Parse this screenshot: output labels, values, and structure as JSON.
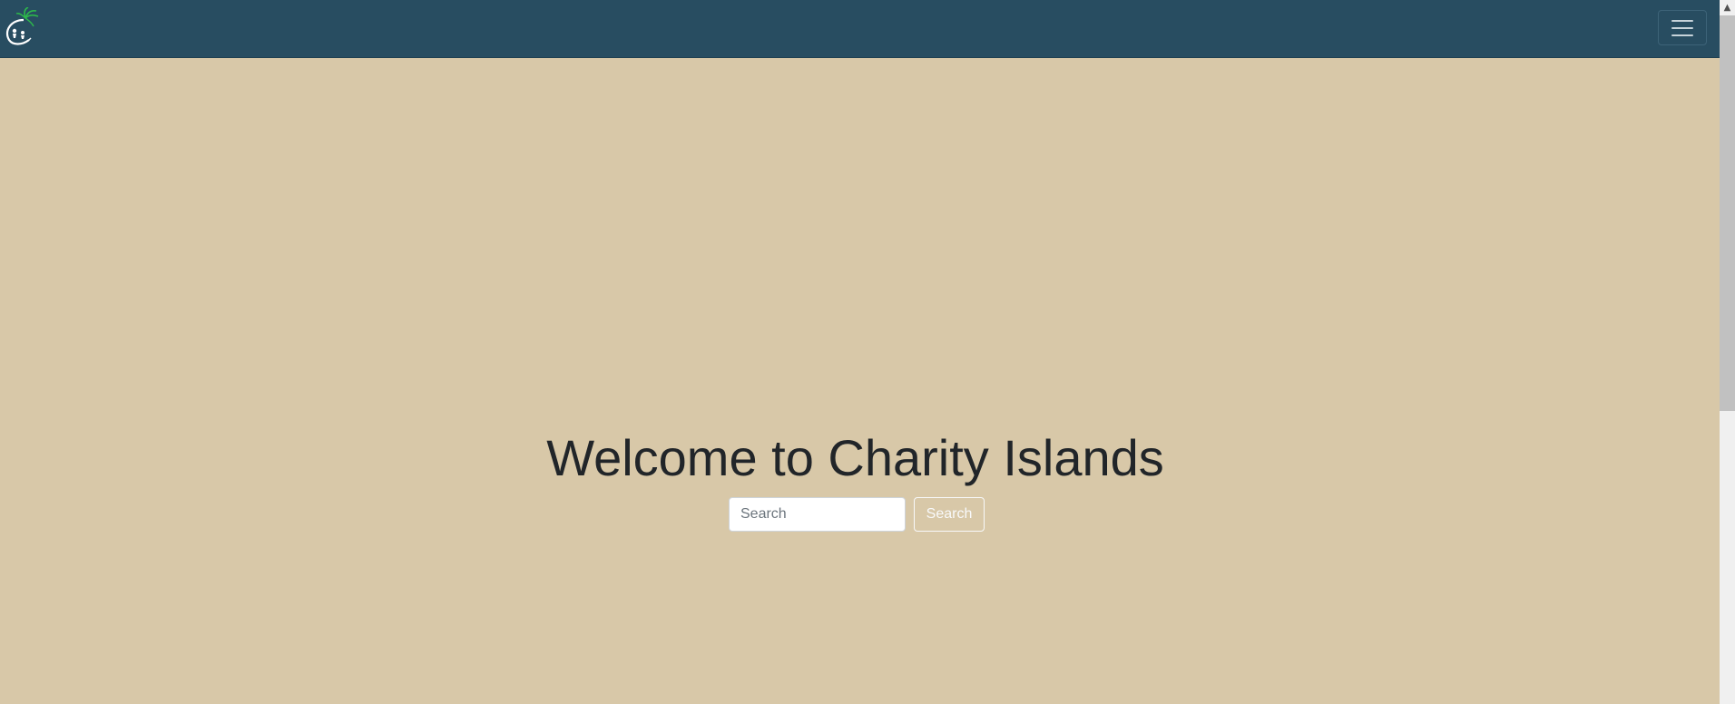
{
  "navbar": {
    "logo_icon": "palm-tree-logo-icon",
    "toggle_icon": "hamburger-menu-icon",
    "background_color": "#284d61",
    "logo_leaf_color": "#2db84b"
  },
  "hero": {
    "title": "Welcome to Charity Islands",
    "background_color": "#d8c8a8"
  },
  "search": {
    "placeholder": "Search",
    "value": "",
    "button_label": "Search"
  },
  "scrollbar": {
    "up_arrow": "▲"
  }
}
